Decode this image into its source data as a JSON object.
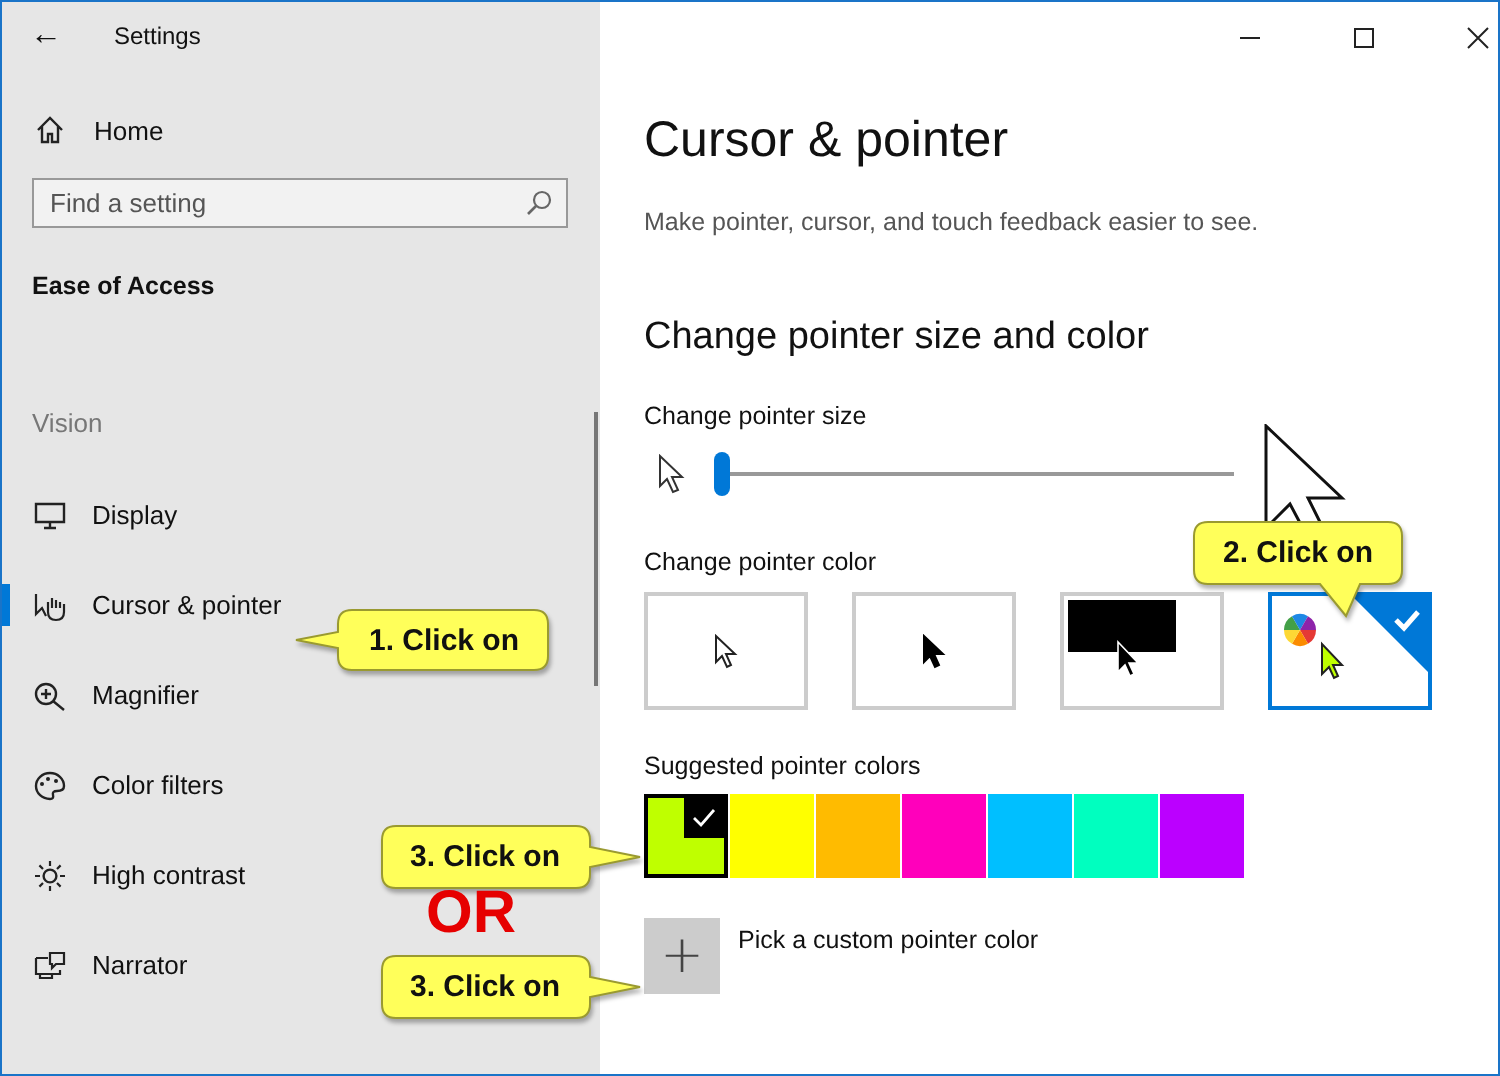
{
  "window": {
    "title": "Settings",
    "back": "←"
  },
  "sidebar": {
    "home": "Home",
    "search": {
      "placeholder": "Find a setting"
    },
    "section": "Ease of Access",
    "group": "Vision",
    "items": [
      {
        "label": "Display",
        "selected": false
      },
      {
        "label": "Cursor & pointer",
        "selected": true
      },
      {
        "label": "Magnifier",
        "selected": false
      },
      {
        "label": "Color filters",
        "selected": false
      },
      {
        "label": "High contrast",
        "selected": false
      },
      {
        "label": "Narrator",
        "selected": false
      }
    ]
  },
  "page": {
    "title": "Cursor & pointer",
    "description": "Make pointer, cursor, and touch feedback easier to see.",
    "heading": "Change pointer size and color",
    "size_label": "Change pointer size",
    "size_slider": {
      "level": 0
    },
    "color_label": "Change pointer color",
    "color_tiles": [
      {
        "kind": "white",
        "selected": false
      },
      {
        "kind": "black",
        "selected": false
      },
      {
        "kind": "inverted",
        "selected": false
      },
      {
        "kind": "custom",
        "selected": true
      }
    ],
    "suggested_label": "Suggested pointer colors",
    "swatches": [
      {
        "color": "#bfff00",
        "selected": true
      },
      {
        "color": "#ffff00",
        "selected": false
      },
      {
        "color": "#ffbb00",
        "selected": false
      },
      {
        "color": "#ff00bb",
        "selected": false
      },
      {
        "color": "#00bfff",
        "selected": false
      },
      {
        "color": "#00ffbf",
        "selected": false
      },
      {
        "color": "#bb00ff",
        "selected": false
      }
    ],
    "custom_button": "+",
    "custom_label": "Pick a custom pointer color"
  },
  "annotations": [
    {
      "kind": "callout",
      "text": "1. Click on"
    },
    {
      "kind": "callout",
      "text": "2. Click on"
    },
    {
      "kind": "callout",
      "text": "3. Click on"
    },
    {
      "kind": "label",
      "text": "OR"
    },
    {
      "kind": "callout",
      "text": "3. Click on"
    }
  ]
}
